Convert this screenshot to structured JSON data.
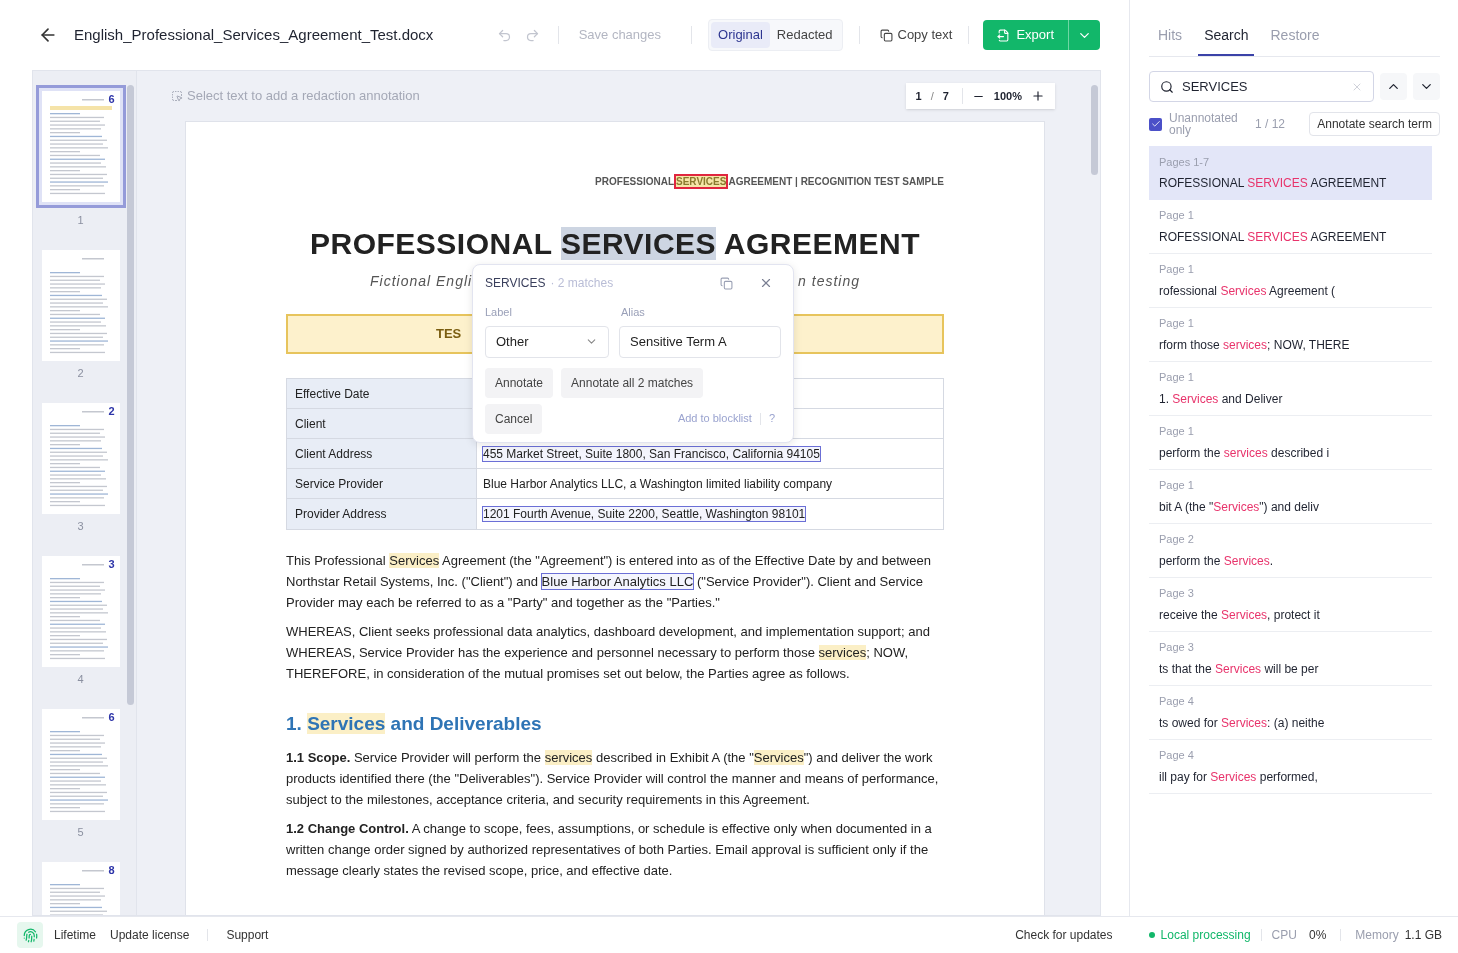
{
  "toolbar": {
    "filename": "English_Professional_Services_Agreement_Test.docx",
    "save_button": {
      "label": "Save changes",
      "disabled": true
    },
    "view_toggle": [
      {
        "label": "Original",
        "selected": true
      },
      {
        "label": "Redacted",
        "selected": false
      }
    ],
    "copy_button": "Copy text",
    "export_button": "Export"
  },
  "thumbnails": [
    {
      "page": "1",
      "badge": "6",
      "selected": true
    },
    {
      "page": "2",
      "selected": false
    },
    {
      "page": "3",
      "badge": "2",
      "selected": false
    },
    {
      "page": "4",
      "badge": "3",
      "selected": false
    },
    {
      "page": "5",
      "badge": "6",
      "selected": false
    },
    {
      "badge": "8",
      "selected": false
    }
  ],
  "viewer": {
    "hint": "Select text to add a redaction annotation",
    "pager": {
      "current": "1",
      "separator": "/",
      "total": "7",
      "zoom": "100%"
    }
  },
  "document": {
    "running_header": [
      {
        "kind": "plain",
        "text": "PROFESSIONAL"
      },
      {
        "kind": "current",
        "text": "SERVICES"
      },
      {
        "kind": "plain",
        "text": "AGREEMENT  |  RECOGNITION TEST SAMPLE"
      }
    ],
    "title": [
      {
        "kind": "plain",
        "text": "PROFESSIONAL "
      },
      {
        "kind": "selected",
        "text": "SERVICES"
      },
      {
        "kind": "plain",
        "text": " AGREEMENT"
      }
    ],
    "subtitle_left": "Fictional Engli",
    "subtitle_right": "n testing",
    "banner": "TES",
    "table": [
      {
        "label": "Effective Date"
      },
      {
        "label": "Client"
      },
      {
        "label": "Client Address",
        "value": [
          {
            "kind": "annotated",
            "text": "455 Market Street, Suite 1800, San Francisco, California 94105"
          }
        ]
      },
      {
        "label": "Service Provider",
        "value": [
          {
            "kind": "plain",
            "text": "Blue Harbor Analytics LLC, a Washington limited liability company"
          }
        ]
      },
      {
        "label": "Provider Address",
        "value": [
          {
            "kind": "annotated",
            "text": "1201 Fourth Avenue, Suite 2200, Seattle, Washington 98101"
          }
        ]
      }
    ],
    "blocks": [
      {
        "kind": "paragraph",
        "segments": [
          {
            "kind": "plain",
            "text": "This Professional "
          },
          {
            "kind": "match",
            "text": "Services"
          },
          {
            "kind": "plain",
            "text": " Agreement (the \"Agreement\") is entered into as of the Effective Date by and between Northstar Retail Systems, Inc. (\"Client\") and "
          },
          {
            "kind": "annotated",
            "text": "Blue Harbor Analytics LLC"
          },
          {
            "kind": "plain",
            "text": " (\"Service Provider\"). Client and Service Provider may each be referred to as a \"Party\" and together as the \"Parties.\""
          }
        ]
      },
      {
        "kind": "paragraph",
        "segments": [
          {
            "kind": "plain",
            "text": "WHEREAS, Client seeks professional data analytics, dashboard development, and implementation support; and WHEREAS, Service Provider has the experience and personnel necessary to perform those "
          },
          {
            "kind": "match",
            "text": "services"
          },
          {
            "kind": "plain",
            "text": "; NOW, THEREFORE, in consideration of the mutual promises set out below, the Parties agree as follows."
          }
        ]
      },
      {
        "kind": "heading",
        "segments": [
          {
            "kind": "plain",
            "text": "1. "
          },
          {
            "kind": "match",
            "text": "Services"
          },
          {
            "kind": "plain",
            "text": " and Deliverables"
          }
        ]
      },
      {
        "kind": "paragraph",
        "segments": [
          {
            "kind": "bold",
            "text": "1.1 Scope."
          },
          {
            "kind": "plain",
            "text": " Service Provider will perform the "
          },
          {
            "kind": "match",
            "text": "services"
          },
          {
            "kind": "plain",
            "text": " described in Exhibit A (the \""
          },
          {
            "kind": "match",
            "text": "Services"
          },
          {
            "kind": "plain",
            "text": "\") and deliver the work products identified there (the \"Deliverables\"). Service Provider will control the manner and means of performance, subject to the milestones, acceptance criteria, and security requirements in this Agreement."
          }
        ]
      },
      {
        "kind": "paragraph",
        "segments": [
          {
            "kind": "bold",
            "text": "1.2 Change Control."
          },
          {
            "kind": "plain",
            "text": " A change to scope, fees, assumptions, or schedule is effective only when documented in a written change order signed by authorized representatives of both Parties. Email approval is sufficient only if the message clearly states the revised scope, price, and effective date."
          }
        ]
      }
    ]
  },
  "popup": {
    "term": "SERVICES",
    "matches": "· 2 matches",
    "label_caption": "Label",
    "label_value": "Other",
    "alias_caption": "Alias",
    "alias_value": "Sensitive Term A",
    "annotate": "Annotate",
    "annotate_all": "Annotate all 2 matches",
    "cancel": "Cancel",
    "blocklist": "Add to blocklist",
    "help": "?"
  },
  "sidebar": {
    "tabs": [
      {
        "label": "Hits",
        "selected": false
      },
      {
        "label": "Search",
        "selected": true
      },
      {
        "label": "Restore",
        "selected": false
      }
    ],
    "search": {
      "value": "SERVICES"
    },
    "unannotated_only": {
      "label": "Unannotated only",
      "checked": true
    },
    "counter": "1 / 12",
    "annotate_button": "Annotate search term",
    "results": [
      {
        "page": "Pages 1-7",
        "before": "ROFESSIONAL ",
        "term": "SERVICES",
        "after": " AGREEMENT",
        "selected": true
      },
      {
        "page": "Page 1",
        "before": "ROFESSIONAL ",
        "term": "SERVICES",
        "after": " AGREEMENT",
        "selected": false
      },
      {
        "page": "Page 1",
        "before": "rofessional ",
        "term": "Services",
        "after": " Agreement (",
        "selected": false
      },
      {
        "page": "Page 1",
        "before": "rform those ",
        "term": "services",
        "after": "; NOW, THERE",
        "selected": false
      },
      {
        "page": "Page 1",
        "before": "1. ",
        "term": "Services",
        "after": " and Deliver",
        "selected": false
      },
      {
        "page": "Page 1",
        "before": "perform the ",
        "term": "services",
        "after": " described i",
        "selected": false
      },
      {
        "page": "Page 1",
        "before": "bit A (the \"",
        "term": "Services",
        "after": "\") and deliv",
        "selected": false
      },
      {
        "page": "Page 2",
        "before": "perform the ",
        "term": "Services",
        "after": ".",
        "selected": false
      },
      {
        "page": "Page 3",
        "before": "receive the ",
        "term": "Services",
        "after": ", protect it",
        "selected": false
      },
      {
        "page": "Page 3",
        "before": "ts that the ",
        "term": "Services",
        "after": " will be per",
        "selected": false
      },
      {
        "page": "Page 4",
        "before": "ts owed for ",
        "term": "Services",
        "after": ": (a) neithe",
        "selected": false
      },
      {
        "page": "Page 4",
        "before": "ill pay for ",
        "term": "Services",
        "after": " performed,",
        "selected": false
      }
    ]
  },
  "footer": {
    "links": [
      "Lifetime",
      "Update license",
      "Support"
    ],
    "check_updates": "Check for updates",
    "status": "Local processing",
    "cpu_label": "CPU",
    "cpu": "0%",
    "memory_label": "Memory",
    "memory": "1.1 GB"
  }
}
